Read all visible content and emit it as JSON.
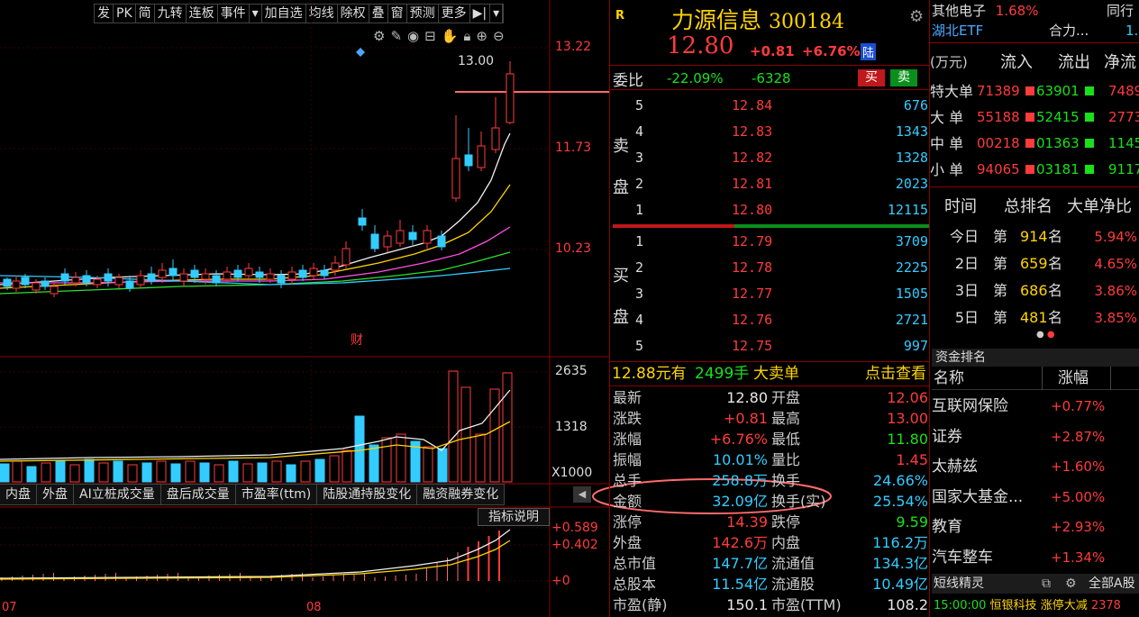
{
  "toolbar": {
    "items": [
      "发",
      "PK",
      "简",
      "九转",
      "连板",
      "事件",
      "▾",
      "加自选",
      "均线",
      "除权",
      "叠",
      "窗",
      "预测",
      "更多",
      "▶|",
      "▾"
    ]
  },
  "chart_tools": {
    "icons": [
      "target-icon",
      "pen-icon",
      "eye-icon",
      "save-icon",
      "hand-icon",
      "lock-icon",
      "zoom-in-icon",
      "zoom-out-icon"
    ]
  },
  "kline": {
    "price_labels": [
      "13.22",
      "11.73",
      "10.23"
    ],
    "high_label": "13.00",
    "finance_marker": "财",
    "volume_labels": [
      "2635",
      "1318",
      "X1000"
    ],
    "indicator_labels": [
      "+0.589",
      "+0.402",
      "+0"
    ],
    "date_labels": [
      "07",
      "08"
    ],
    "indicator_button": "指标说明"
  },
  "bottom_tabs": [
    "内盘",
    "外盘",
    "AI立桩成交量",
    "盘后成交量",
    "市盈率(ttm)",
    "陆股通持股变化",
    "融资融券变化"
  ],
  "stock": {
    "badge": "R",
    "name": "力源信息",
    "code": "300184",
    "price": "12.80",
    "change": "+0.81",
    "pct": "+6.76%",
    "tag": "陆"
  },
  "weibi": {
    "label": "委比",
    "pct": "-22.09%",
    "diff": "-6328",
    "buy": "买",
    "sell": "卖"
  },
  "sell_label": [
    "卖",
    "盘"
  ],
  "buy_label": [
    "买",
    "盘"
  ],
  "asks": [
    {
      "lvl": "5",
      "price": "12.84",
      "vol": "676"
    },
    {
      "lvl": "4",
      "price": "12.83",
      "vol": "1343"
    },
    {
      "lvl": "3",
      "price": "12.82",
      "vol": "1328"
    },
    {
      "lvl": "2",
      "price": "12.81",
      "vol": "2023"
    },
    {
      "lvl": "1",
      "price": "12.80",
      "vol": "12115"
    }
  ],
  "bids": [
    {
      "lvl": "1",
      "price": "12.79",
      "vol": "3709"
    },
    {
      "lvl": "2",
      "price": "12.78",
      "vol": "2225"
    },
    {
      "lvl": "3",
      "price": "12.77",
      "vol": "1505"
    },
    {
      "lvl": "4",
      "price": "12.76",
      "vol": "2721"
    },
    {
      "lvl": "5",
      "price": "12.75",
      "vol": "997"
    }
  ],
  "big_order": {
    "text1": "12.88元有",
    "vol": "2499手",
    "text2": "大卖单",
    "link": "点击查看"
  },
  "stats": [
    {
      "k1": "最新",
      "v1": "12.80",
      "k2": "开盘",
      "v2": "12.06"
    },
    {
      "k1": "涨跌",
      "v1": "+0.81",
      "k2": "最高",
      "v2": "13.00"
    },
    {
      "k1": "涨幅",
      "v1": "+6.76%",
      "k2": "最低",
      "v2": "11.80"
    },
    {
      "k1": "振幅",
      "v1": "10.01%",
      "k2": "量比",
      "v2": "1.45"
    },
    {
      "k1": "总手",
      "v1": "258.8万",
      "k2": "换手",
      "v2": "24.66%"
    },
    {
      "k1": "金额",
      "v1": "32.09亿",
      "k2": "换手(实)",
      "v2": "25.54%"
    },
    {
      "k1": "涨停",
      "v1": "14.39",
      "k2": "跌停",
      "v2": "9.59"
    },
    {
      "k1": "外盘",
      "v1": "142.6万",
      "k2": "内盘",
      "v2": "116.2万"
    },
    {
      "k1": "总市值",
      "v1": "147.7亿",
      "k2": "流通值",
      "v2": "134.3亿"
    },
    {
      "k1": "总股本",
      "v1": "11.54亿",
      "k2": "流通股",
      "v2": "10.49亿"
    },
    {
      "k1": "市盈(静)",
      "v1": "150.1",
      "k2": "市盈(TTM)",
      "v2": "108.2"
    }
  ],
  "sector": {
    "name": "其他电子",
    "pct": "1.68%",
    "right": "同行"
  },
  "sector2": {
    "name": "湖北ETF",
    "right": "合力...",
    "right2": "1."
  },
  "fund_flow": {
    "header": [
      "(万元)",
      "流入",
      "流出",
      "净流"
    ],
    "rows": [
      {
        "label": "特大单",
        "in": "71389",
        "out": "63901",
        "net": "7489"
      },
      {
        "label": "大 单",
        "in": "55188",
        "out": "52415",
        "net": "2773"
      },
      {
        "label": "中 单",
        "in": "00218",
        "out": "01363",
        "net": "1145"
      },
      {
        "label": "小 单",
        "in": "94065",
        "out": "03181",
        "net": "9117"
      }
    ]
  },
  "ranking": {
    "header": [
      "时间",
      "总排名",
      "大单净比"
    ],
    "rows": [
      {
        "t": "今日",
        "pre": "第",
        "rank": "914",
        "suf": "名",
        "pct": "5.94%"
      },
      {
        "t": "2日",
        "pre": "第",
        "rank": "659",
        "suf": "名",
        "pct": "4.65%"
      },
      {
        "t": "3日",
        "pre": "第",
        "rank": "686",
        "suf": "名",
        "pct": "3.86%"
      },
      {
        "t": "5日",
        "pre": "第",
        "rank": "481",
        "suf": "名",
        "pct": "3.85%"
      }
    ]
  },
  "sector_rank": {
    "title": "资金排名",
    "header": [
      "名称",
      "涨幅"
    ],
    "rows": [
      {
        "name": "互联网保险",
        "chg": "+0.77%"
      },
      {
        "name": "证券",
        "chg": "+2.87%"
      },
      {
        "name": "太赫兹",
        "chg": "+1.60%"
      },
      {
        "name": "国家大基金...",
        "chg": "+5.00%"
      },
      {
        "name": "教育",
        "chg": "+2.93%"
      },
      {
        "name": "汽车整车",
        "chg": "+1.34%"
      }
    ]
  },
  "footer": {
    "title": "短线精灵",
    "btn": "全部A股",
    "news_time": "15:00:00",
    "news_name": "恒银科技",
    "news_event": "涨停大减",
    "news_num": "2378"
  },
  "colors": {
    "up": "#ff3b3b",
    "down": "#19e019",
    "accent": "#3cf",
    "yellow": "#ffd400",
    "bg": "#000000"
  }
}
